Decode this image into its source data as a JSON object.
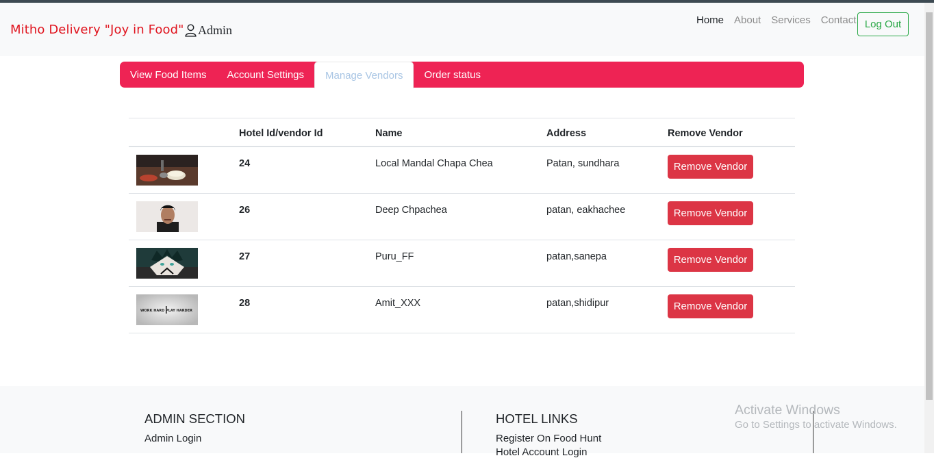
{
  "navbar": {
    "brand": "Mitho Delivery \"Joy in Food\"",
    "user_label": "Admin",
    "links": [
      "Home",
      "About",
      "Services",
      "Contact"
    ],
    "logout_label": "Log Out"
  },
  "tabs": [
    "View Food Items",
    "Account Settings",
    "Manage Vendors",
    "Order status"
  ],
  "table": {
    "headers": [
      "",
      "Hotel Id/vendor Id",
      "Name",
      "Address",
      "Remove Vendor"
    ],
    "rows": [
      {
        "id": "24",
        "name": "Local Mandal Chapa Chea",
        "address": "Patan, sundhara",
        "button": "Remove Vendor"
      },
      {
        "id": "26",
        "name": "Deep Chpachea",
        "address": "patan, eakhachee",
        "button": "Remove Vendor"
      },
      {
        "id": "27",
        "name": "Puru_FF",
        "address": "patan,sanepa",
        "button": "Remove Vendor"
      },
      {
        "id": "28",
        "name": "Amit_XXX",
        "address": "patan,shidipur",
        "button": "Remove Vendor"
      }
    ],
    "row4_image_text": "WORK HARD PLAY HARDER"
  },
  "footer": {
    "admin_title": "ADMIN SECTION",
    "admin_links": [
      "Admin Login"
    ],
    "hotel_title": "HOTEL LINKS",
    "hotel_links": [
      "Register On Food Hunt",
      "Hotel Account Login"
    ]
  },
  "watermark": {
    "line1": "Activate Windows",
    "line2": "Go to Settings to activate Windows."
  },
  "colors": {
    "brand": "#e0141e",
    "tabbar": "#ee2354",
    "danger": "#dc3545",
    "success": "#28a745"
  }
}
